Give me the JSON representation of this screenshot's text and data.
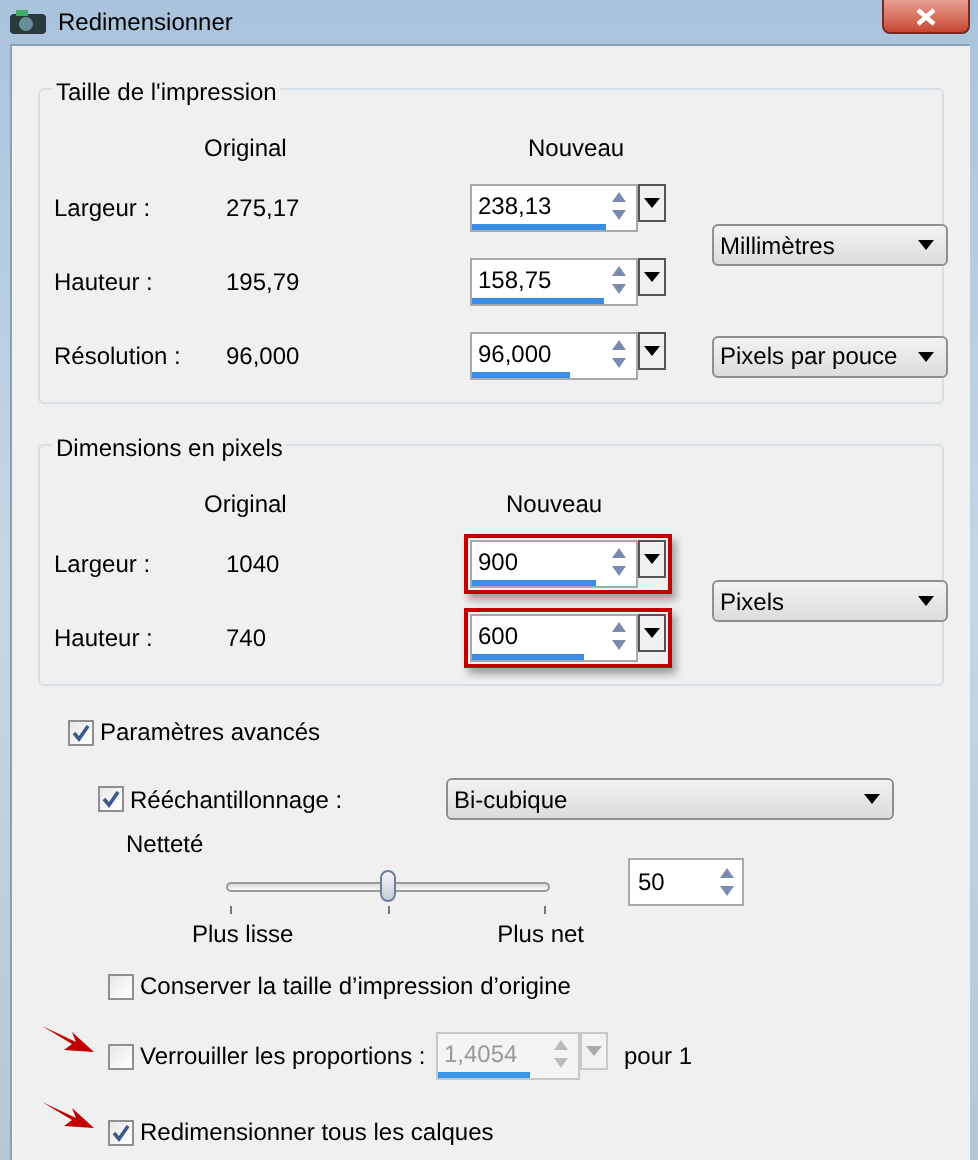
{
  "window": {
    "title": "Redimensionner"
  },
  "sections": [
    {
      "title": "Taille de l'impression",
      "headers": {
        "original": "Original",
        "new": "Nouveau"
      },
      "groups": [
        {
          "unit": "Millimètres",
          "rows": [
            {
              "label": "Largeur :",
              "original": "275,17",
              "field": {
                "value": "238,13",
                "level": 0.82,
                "highlighted": false
              }
            },
            {
              "label": "Hauteur :",
              "original": "195,79",
              "field": {
                "value": "158,75",
                "level": 0.8,
                "highlighted": false
              }
            }
          ]
        },
        {
          "unit": "Pixels par pouce",
          "rows": [
            {
              "label": "Résolution :",
              "original": "96,000",
              "field": {
                "value": "96,000",
                "level": 0.6,
                "highlighted": false
              }
            }
          ]
        }
      ]
    },
    {
      "title": "Dimensions en pixels",
      "headers": {
        "original": "Original",
        "new": "Nouveau"
      },
      "groups": [
        {
          "unit": "Pixels",
          "rows": [
            {
              "label": "Largeur :",
              "original": "1040",
              "field": {
                "value": "900",
                "level": 0.75,
                "highlighted": true
              }
            },
            {
              "label": "Hauteur :",
              "original": "740",
              "field": {
                "value": "600",
                "level": 0.68,
                "highlighted": true
              }
            }
          ]
        }
      ]
    }
  ],
  "advanced": {
    "label": "Paramètres avancés",
    "checked": true
  },
  "resampling": {
    "label": "Rééchantillonnage :",
    "checked": true,
    "method": "Bi-cubique"
  },
  "sharpness": {
    "label": "Netteté",
    "level": 0.5,
    "min_label": "Plus lisse",
    "max_label": "Plus net",
    "value": "50"
  },
  "keep_print_size": {
    "label": "Conserver la taille d’impression d’origine",
    "checked": false
  },
  "lock_ratio": {
    "label": "Verrouiller les proportions :",
    "checked": false,
    "arrow": true,
    "field": {
      "value": "1,4054",
      "level": 0.65,
      "disabled": true
    },
    "suffix": "pour 1"
  },
  "resize_layers": {
    "label": "Redimensionner tous les calques",
    "checked": true,
    "arrow": true
  }
}
